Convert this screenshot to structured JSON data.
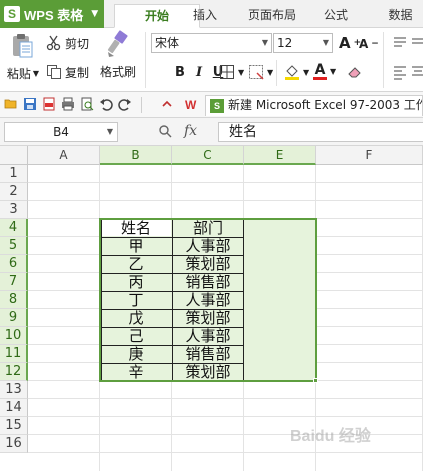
{
  "app": {
    "name": "WPS 表格",
    "logo_letter": "S"
  },
  "tabs": [
    "开始",
    "插入",
    "页面布局",
    "公式",
    "数据"
  ],
  "active_tab": "开始",
  "ribbon": {
    "paste_label": "粘贴",
    "cut_label": "剪切",
    "copy_label": "复制",
    "format_painter_label": "格式刷",
    "font_name": "宋体",
    "font_size": "12",
    "bold": "B",
    "italic": "I",
    "underline": "U",
    "grow_font": "A",
    "shrink_font": "A",
    "font_color_letter": "A"
  },
  "document_tab": {
    "title": "新建 Microsoft Excel 97-2003 工作",
    "badge": "W"
  },
  "formula_bar": {
    "name_box": "B4",
    "fx_label": "fx",
    "value": "姓名"
  },
  "sheet": {
    "columns": [
      "A",
      "B",
      "C",
      "E",
      "F"
    ],
    "selected_columns": [
      "B",
      "C",
      "E"
    ],
    "rows": [
      "1",
      "2",
      "3",
      "4",
      "5",
      "6",
      "7",
      "8",
      "9",
      "10",
      "11",
      "12",
      "13",
      "14",
      "15",
      "16"
    ],
    "selected_rows": [
      "4",
      "5",
      "6",
      "7",
      "8",
      "9",
      "10",
      "11",
      "12"
    ],
    "table": {
      "headers": [
        "姓名",
        "部门"
      ],
      "rows": [
        [
          "甲",
          "人事部"
        ],
        [
          "乙",
          "策划部"
        ],
        [
          "丙",
          "销售部"
        ],
        [
          "丁",
          "人事部"
        ],
        [
          "戊",
          "策划部"
        ],
        [
          "己",
          "人事部"
        ],
        [
          "庚",
          "销售部"
        ],
        [
          "辛",
          "策划部"
        ]
      ]
    }
  },
  "colors": {
    "brand_green": "#5b9d37",
    "selection_fill": "#e6f3dc",
    "selection_border": "#5e9e3f"
  },
  "watermark": "Baidu 经验"
}
